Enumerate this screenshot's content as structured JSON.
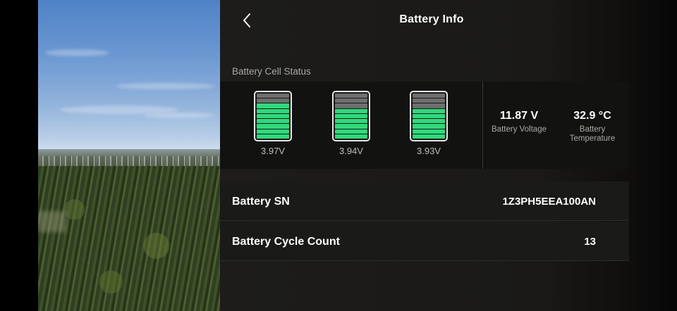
{
  "header": {
    "title": "Battery Info"
  },
  "battery_cell_status": {
    "section_label": "Battery Cell Status",
    "cells": [
      {
        "voltage_label": "3.97V",
        "charge_segments_filled": 7,
        "charge_segments_total": 9
      },
      {
        "voltage_label": "3.94V",
        "charge_segments_filled": 6,
        "charge_segments_total": 9
      },
      {
        "voltage_label": "3.93V",
        "charge_segments_filled": 6,
        "charge_segments_total": 9
      }
    ],
    "stats": {
      "voltage_value": "11.87 V",
      "voltage_label": "Battery Voltage",
      "temperature_value": "32.9 °C",
      "temperature_label": "Battery Temperature"
    }
  },
  "details": {
    "sn_label": "Battery SN",
    "sn_value": "1Z3PH5EEA100AN",
    "cycle_label": "Battery Cycle Count",
    "cycle_value": "13"
  },
  "colors": {
    "cell_full": "#2fd97b",
    "cell_empty": "#6f6f6f"
  },
  "icons": {
    "back": "chevron-left-icon"
  }
}
